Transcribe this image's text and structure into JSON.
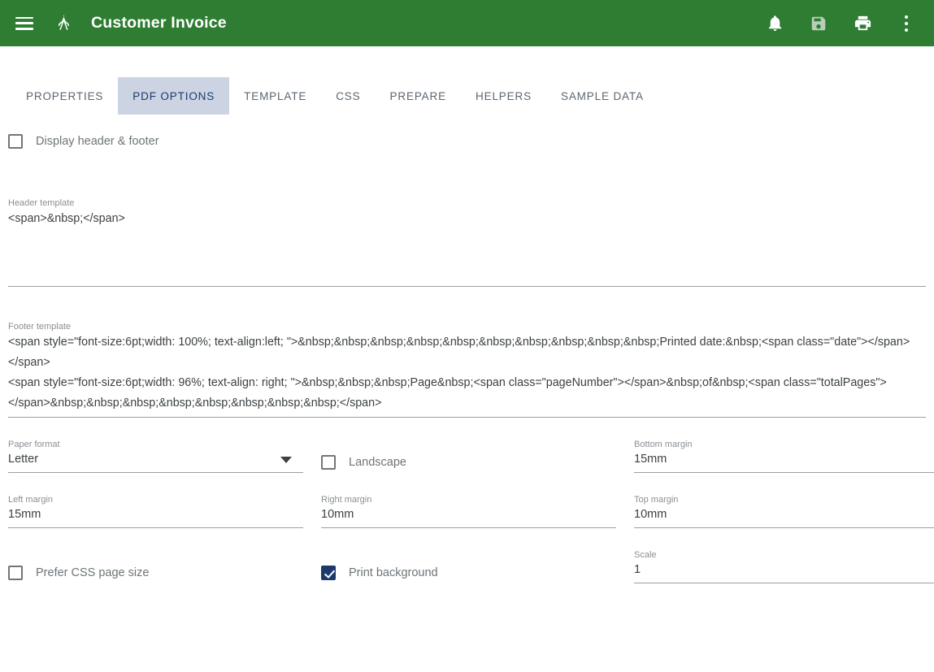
{
  "appbar": {
    "menu_icon": "hamburger-menu-icon",
    "logo_icon": "compass-logo-icon",
    "title": "Customer Invoice",
    "actions": [
      {
        "name": "notifications-icon",
        "glyph": "bell"
      },
      {
        "name": "save-icon",
        "glyph": "floppy-disk"
      },
      {
        "name": "print-icon",
        "glyph": "printer"
      },
      {
        "name": "overflow-menu-icon",
        "glyph": "kebab"
      }
    ]
  },
  "tabs": [
    {
      "label": "PROPERTIES",
      "active": false
    },
    {
      "label": "PDF OPTIONS",
      "active": true
    },
    {
      "label": "TEMPLATE",
      "active": false
    },
    {
      "label": "CSS",
      "active": false
    },
    {
      "label": "PREPARE",
      "active": false
    },
    {
      "label": "HELPERS",
      "active": false
    },
    {
      "label": "SAMPLE DATA",
      "active": false
    }
  ],
  "form": {
    "display_header_footer": {
      "label": "Display header & footer",
      "checked": false
    },
    "header_template": {
      "label": "Header template",
      "value": "<span>&nbsp;</span>"
    },
    "footer_template": {
      "label": "Footer template",
      "line1": "<span style=\"font-size:6pt;width: 100%; text-align:left; \">&nbsp;&nbsp;&nbsp;&nbsp;&nbsp;&nbsp;&nbsp;&nbsp;&nbsp;&nbsp;Printed date:&nbsp;<span class=\"date\"></span>",
      "line2": "</span>",
      "line3": "<span style=\"font-size:6pt;width: 96%; text-align: right; \">&nbsp;&nbsp;&nbsp;Page&nbsp;<span class=\"pageNumber\"></span>&nbsp;of&nbsp;<span class=\"totalPages\">",
      "line4": "</span>&nbsp;&nbsp;&nbsp;&nbsp;&nbsp;&nbsp;&nbsp;&nbsp;</span>"
    },
    "paper_format": {
      "label": "Paper format",
      "value": "Letter"
    },
    "landscape": {
      "label": "Landscape",
      "checked": false
    },
    "bottom_margin": {
      "label": "Bottom margin",
      "value": "15mm"
    },
    "left_margin": {
      "label": "Left margin",
      "value": "15mm"
    },
    "right_margin": {
      "label": "Right margin",
      "value": "10mm"
    },
    "top_margin": {
      "label": "Top margin",
      "value": "10mm"
    },
    "prefer_css_page_size": {
      "label": "Prefer CSS page size",
      "checked": false
    },
    "print_background": {
      "label": "Print background",
      "checked": true
    },
    "scale": {
      "label": "Scale",
      "value": "1"
    }
  },
  "colors": {
    "appbar_green": "#2e7d32",
    "active_tab_bg": "#ccd4e4",
    "active_tab_text": "#1b3a6b",
    "checkbox_checked": "#1b3a6b"
  }
}
